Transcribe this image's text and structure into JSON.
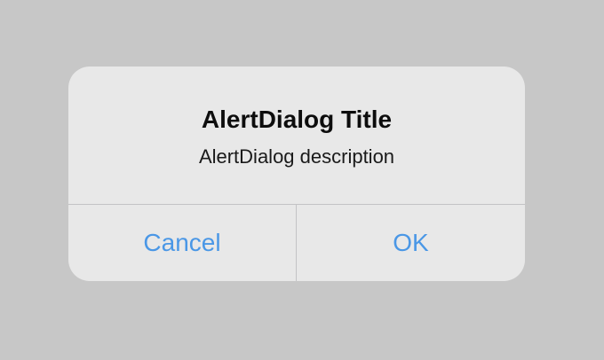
{
  "dialog": {
    "title": "AlertDialog Title",
    "description": "AlertDialog description",
    "buttons": {
      "cancel_label": "Cancel",
      "ok_label": "OK"
    },
    "colors": {
      "button_text": "#4a97e6",
      "backdrop": "#c7c7c7",
      "surface": "#e8e8e8"
    }
  }
}
